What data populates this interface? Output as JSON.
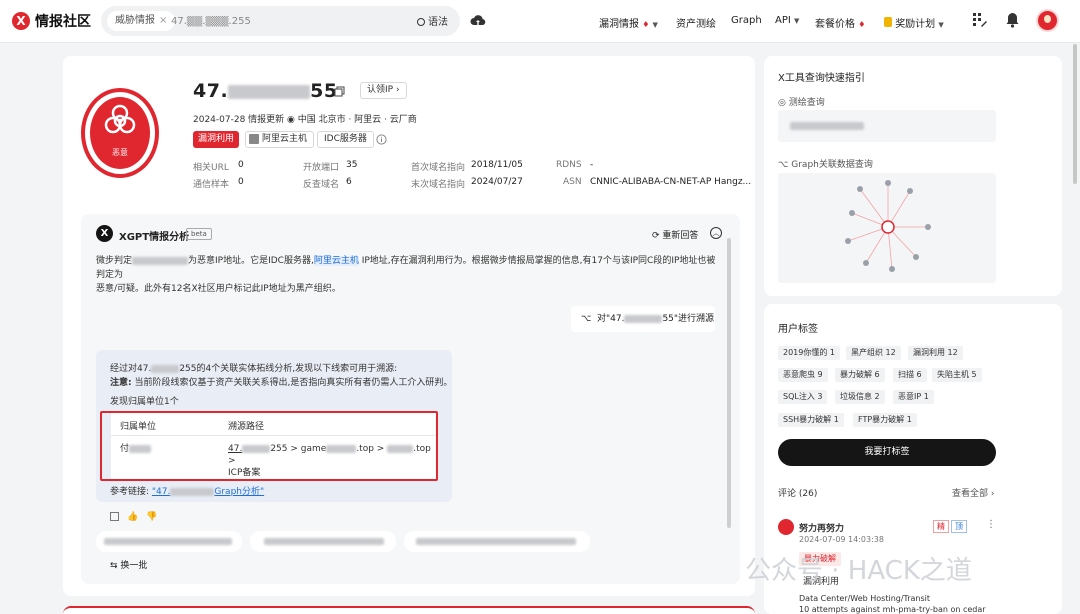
{
  "nav": {
    "logo_text": "情报社区",
    "search_chip": "威胁情报",
    "search_chip_close": "×",
    "search_value": "47.▒▒.▒▒▒.255",
    "search_button": "语法",
    "menu": [
      {
        "label": "漏洞情报",
        "fire": true,
        "caret": true
      },
      {
        "label": "资产测绘"
      },
      {
        "label": "Graph"
      },
      {
        "label": "API",
        "caret": true
      },
      {
        "label": "套餐价格",
        "fire": true
      },
      {
        "label": "奖励计划",
        "coin": true,
        "caret": true
      }
    ]
  },
  "ip": {
    "prefix": "47.",
    "suffix": "55",
    "auth_button": "认领IP",
    "date_text": "2024-07-28 情报更新",
    "location": "中国 北京市 · 阿里云 · 云厂商",
    "verdict": "恶意",
    "tags": [
      "漏洞利用",
      "阿里云主机",
      "IDC服务器"
    ],
    "stats": [
      {
        "k": "相关URL",
        "v": "0"
      },
      {
        "k": "开放端口",
        "v": "35"
      },
      {
        "k": "首次域名指向",
        "v": "2018/11/05"
      },
      {
        "k": "RDNS",
        "v": "-"
      },
      {
        "k": "通信样本",
        "v": "0"
      },
      {
        "k": "反查域名",
        "v": "6"
      },
      {
        "k": "末次域名指向",
        "v": "2024/07/27"
      },
      {
        "k": "ASN",
        "v": "CNNIC-ALIBABA-CN-NET-AP Hangz..."
      }
    ]
  },
  "xgpt": {
    "title": "XGPT情报分析",
    "beta": "beta",
    "regen": "重新回答",
    "para_a": "微步判定",
    "para_b": "为恶意IP地址。它是IDC服务器,",
    "para_link": "阿里云主机",
    "para_c": " IP地址,存在漏洞利用行为。根据微步情报局掌握的信息,有17个与该IP同C段的IP地址也被判定为",
    "para_d": "恶意/可疑。此外有12名X社区用户标记此IP地址为黑产组织。",
    "bubble_a": "对\"47.",
    "bubble_b": "55\"进行溯源",
    "an_a": "经过对47.",
    "an_b": "255的4个关联实体拓线分析,发现以下线索可用于溯源:",
    "note_label": "注意:",
    "note_text": "当前阶段线索仅基于资产关联关系得出,是否指向真实所有者仍需人工介入研判。",
    "found": "发现归属单位1个",
    "th_unit": "归属单位",
    "th_path": "溯源路径",
    "unit_prefix": "付",
    "path_a": "47.",
    "path_b": "255 > game",
    "path_c": ".top >",
    "path_d": ".top >",
    "path_e": "ICP备案",
    "ref_label": "参考链接:",
    "ref_a": "\"47.",
    "ref_b": "Graph分析\"",
    "swap": "换一批"
  },
  "side": {
    "quick_title": "X工具查询快速指引",
    "map_query": "测绘查询",
    "graph_query": "Graph关联数据查询",
    "tags_title": "用户标签",
    "user_tags": [
      [
        "2019你懂的 1",
        "黑产组织 12",
        "漏洞利用 12"
      ],
      [
        "恶意爬虫 9",
        "暴力破解 6",
        "扫描 6",
        "失陷主机 5"
      ],
      [
        "SQL注入 3",
        "垃圾信息 2",
        "恶意IP 1"
      ],
      [
        "SSH暴力破解 1",
        "FTP暴力破解 1"
      ]
    ],
    "tag_button": "我要打标签",
    "comments": "评论 (26)",
    "view_all": "查看全部",
    "commenter": "努力再努力",
    "comment_time": "2024-07-09 14:03:38",
    "jing": "精",
    "ding": "顶",
    "comment_tag": "暴力破解",
    "comment_label": "漏洞利用",
    "comment_line1": "Data Center/Web Hosting/Transit",
    "comment_line2": "10 attempts against mh-pma-try-ban on cedar"
  },
  "watermark": "公众号 · HACK之道",
  "colors": {
    "accent": "#e0262f",
    "link": "#1e6fd9",
    "dark": "#151515"
  }
}
